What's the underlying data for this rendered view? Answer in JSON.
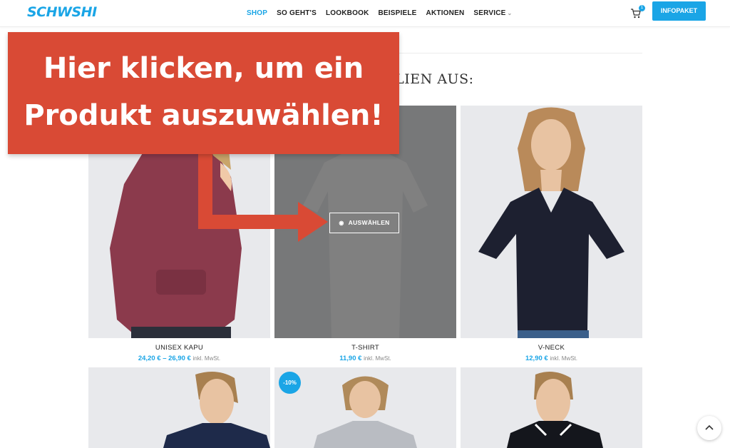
{
  "header": {
    "logo": "SCHWSHI",
    "nav": [
      {
        "label": "SHOP",
        "active": true
      },
      {
        "label": "SO GEHT'S",
        "active": false
      },
      {
        "label": "LOOKBOOK",
        "active": false
      },
      {
        "label": "BEISPIELE",
        "active": false
      },
      {
        "label": "AKTIONEN",
        "active": false
      },
      {
        "label": "SERVICE",
        "active": false,
        "chevron": "⌄"
      }
    ],
    "cart_count": "1",
    "cart_icon": "cart-icon",
    "info_button": "INFOPAKET"
  },
  "section_title_visible": "TILIEN AUS:",
  "callout": {
    "line1": "Hier klicken, um ein",
    "line2": "Produkt auszuwählen!"
  },
  "products": [
    {
      "name": "UNISEX KAPU",
      "price": "24,20 € – 26,90 €",
      "vat": "inkl. MwSt."
    },
    {
      "name": "T-SHIRT",
      "price": "11,90 €",
      "vat": "inkl. MwSt.",
      "hover_button": "AUSWÄHLEN"
    },
    {
      "name": "V-NECK",
      "price": "12,90 €",
      "vat": "inkl. MwSt."
    }
  ],
  "second_row_badge": "-10%",
  "colors": {
    "accent": "#1aa5e6",
    "callout": "#d94a35"
  }
}
